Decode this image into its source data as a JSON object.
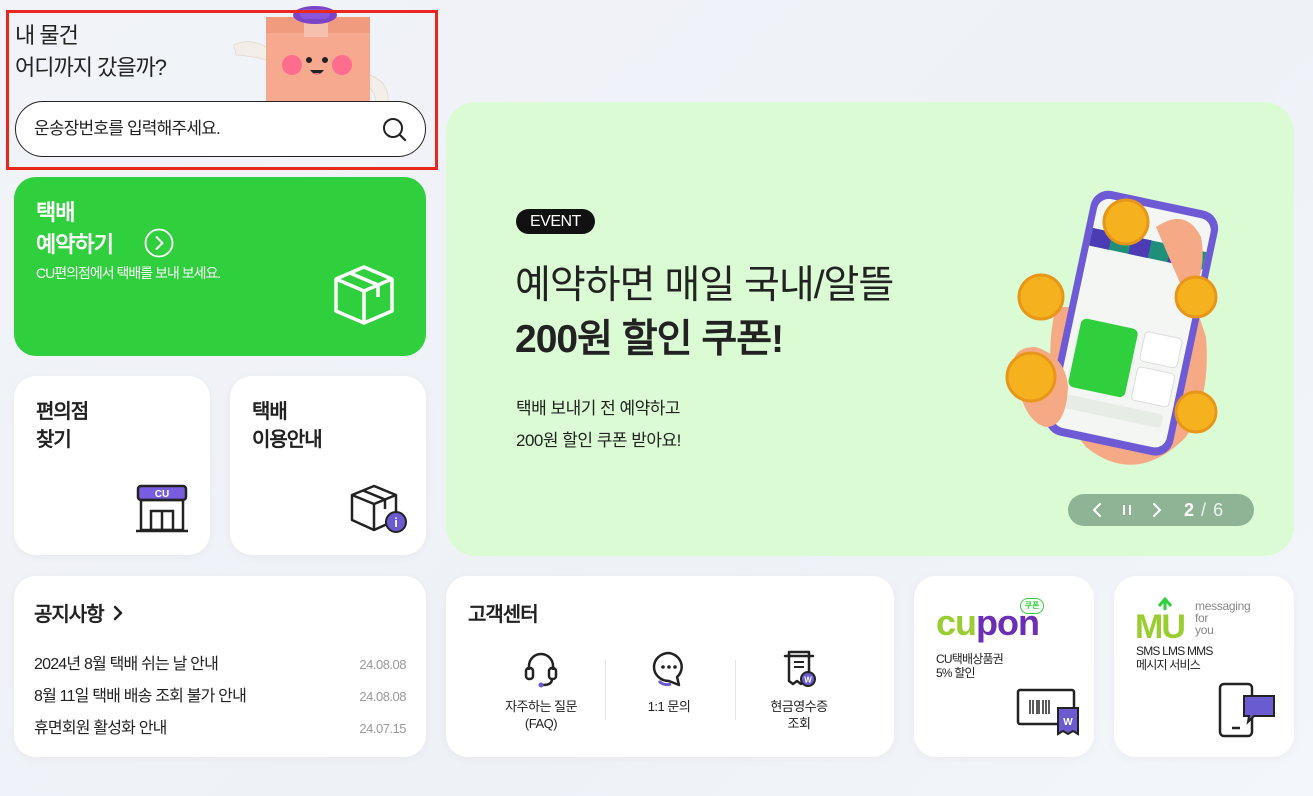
{
  "search": {
    "headline_line1": "내 물건",
    "headline_line2": "어디까지 갔을까?",
    "placeholder": "운송장번호를 입력해주세요."
  },
  "reserve_card": {
    "title_line1": "택배",
    "title_line2": "예약하기",
    "subtitle": "CU편의점에서 택배를 보내 보세요.",
    "accent_color": "#30cf3d"
  },
  "store_card": {
    "title_line1": "편의점",
    "title_line2": "찾기",
    "logo_text": "CU"
  },
  "guide_card": {
    "title_line1": "택배",
    "title_line2": "이용안내"
  },
  "banner": {
    "badge": "EVENT",
    "headline1": "예약하면 매일 국내/알뜰",
    "headline2": "200원 할인 쿠폰!",
    "desc1": "택배 보내기 전 예약하고",
    "desc2": "200원 할인 쿠폰 받아요!",
    "background": "#dbfbd5",
    "slider": {
      "current": "2",
      "separator": "/",
      "total": "6"
    }
  },
  "notice": {
    "title": "공지사항",
    "items": [
      {
        "text": "2024년 8월 택배 쉬는 날 안내",
        "date": "24.08.08"
      },
      {
        "text": "8월 11일 택배 배송 조회 불가 안내",
        "date": "24.08.08"
      },
      {
        "text": "휴면회원 활성화 안내",
        "date": "24.07.15"
      }
    ]
  },
  "customer_center": {
    "title": "고객센터",
    "items": [
      {
        "line1": "자주하는 질문",
        "line2": "(FAQ)"
      },
      {
        "line1": "1:1 문의",
        "line2": ""
      },
      {
        "line1": "현금영수증",
        "line2": "조회"
      }
    ]
  },
  "cupon": {
    "badge": "쿠폰",
    "logo_cu": "cu",
    "logo_pon": "pon",
    "desc1": "CU택배상품권",
    "desc2": "5% 할인",
    "ticket_mark": "W"
  },
  "mu": {
    "logo": "MU",
    "tag1": "messaging",
    "tag2": "for",
    "tag3": "you",
    "desc1": "SMS LMS MMS",
    "desc2": "메시지 서비스"
  }
}
